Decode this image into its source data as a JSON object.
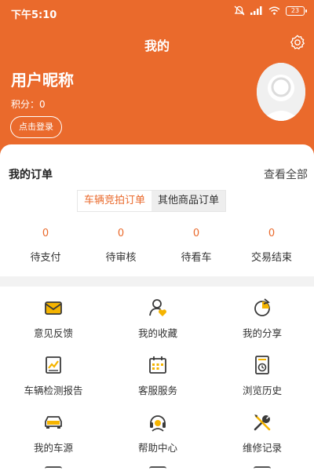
{
  "status_bar": {
    "time": "下午5:10",
    "battery": "23"
  },
  "header": {
    "title": "我的"
  },
  "profile": {
    "nickname": "用户昵称",
    "points_label": "积分：",
    "points": "0",
    "login_label": "点击登录"
  },
  "orders": {
    "title": "我的订单",
    "view_all": "查看全部",
    "tabs": [
      {
        "label": "车辆竞拍订单",
        "active": true
      },
      {
        "label": "其他商品订单",
        "active": false
      }
    ],
    "stats": [
      {
        "count": "0",
        "label": "待支付"
      },
      {
        "count": "0",
        "label": "待审核"
      },
      {
        "count": "0",
        "label": "待看车"
      },
      {
        "count": "0",
        "label": "交易结束"
      }
    ]
  },
  "services": [
    {
      "label": "意见反馈",
      "icon": "feedback-icon"
    },
    {
      "label": "我的收藏",
      "icon": "favorites-icon"
    },
    {
      "label": "我的分享",
      "icon": "share-icon"
    },
    {
      "label": "车辆检测报告",
      "icon": "report-icon"
    },
    {
      "label": "客服服务",
      "icon": "calendar-icon"
    },
    {
      "label": "浏览历史",
      "icon": "history-icon"
    },
    {
      "label": "我的车源",
      "icon": "car-icon"
    },
    {
      "label": "帮助中心",
      "icon": "headset-icon"
    },
    {
      "label": "维修记录",
      "icon": "tools-icon"
    }
  ],
  "colors": {
    "accent": "#ea6a2c",
    "background": "#f2f2f2",
    "icon_dark": "#3a3a3a",
    "icon_yellow": "#f5b400"
  }
}
